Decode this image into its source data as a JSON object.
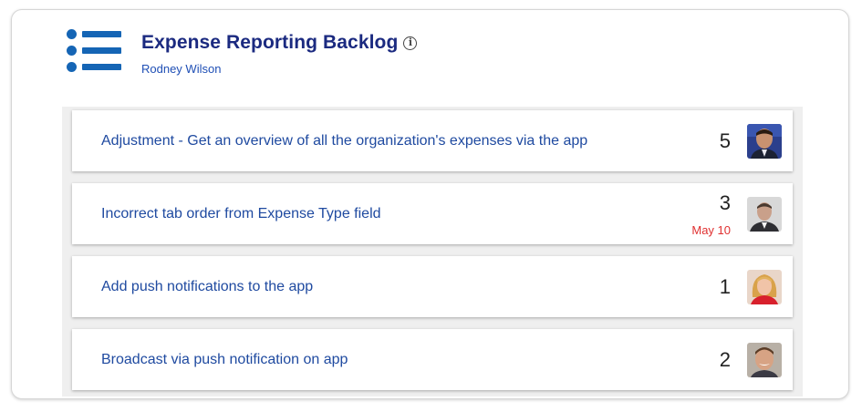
{
  "header": {
    "title": "Expense Reporting Backlog",
    "owner": "Rodney Wilson",
    "info_icon": "info-icon",
    "list_icon": "list-bullets-icon",
    "accent_color": "#1565b5",
    "title_color": "#1b2a80"
  },
  "items": [
    {
      "title": "Adjustment - Get an overview of all the organization's expenses via the app",
      "count": "5",
      "date": "",
      "avatar": "avatar-man-dark-suit"
    },
    {
      "title": "Incorrect tab order from Expense Type field",
      "count": "3",
      "date": "May 10",
      "avatar": "avatar-man-grey"
    },
    {
      "title": "Add push notifications to the app",
      "count": "1",
      "date": "",
      "avatar": "avatar-woman-blonde"
    },
    {
      "title": "Broadcast via push notification on app",
      "count": "2",
      "date": "",
      "avatar": "avatar-man-smiling"
    }
  ],
  "colors": {
    "date_due": "#e03030",
    "item_link": "#1f4aa0"
  }
}
